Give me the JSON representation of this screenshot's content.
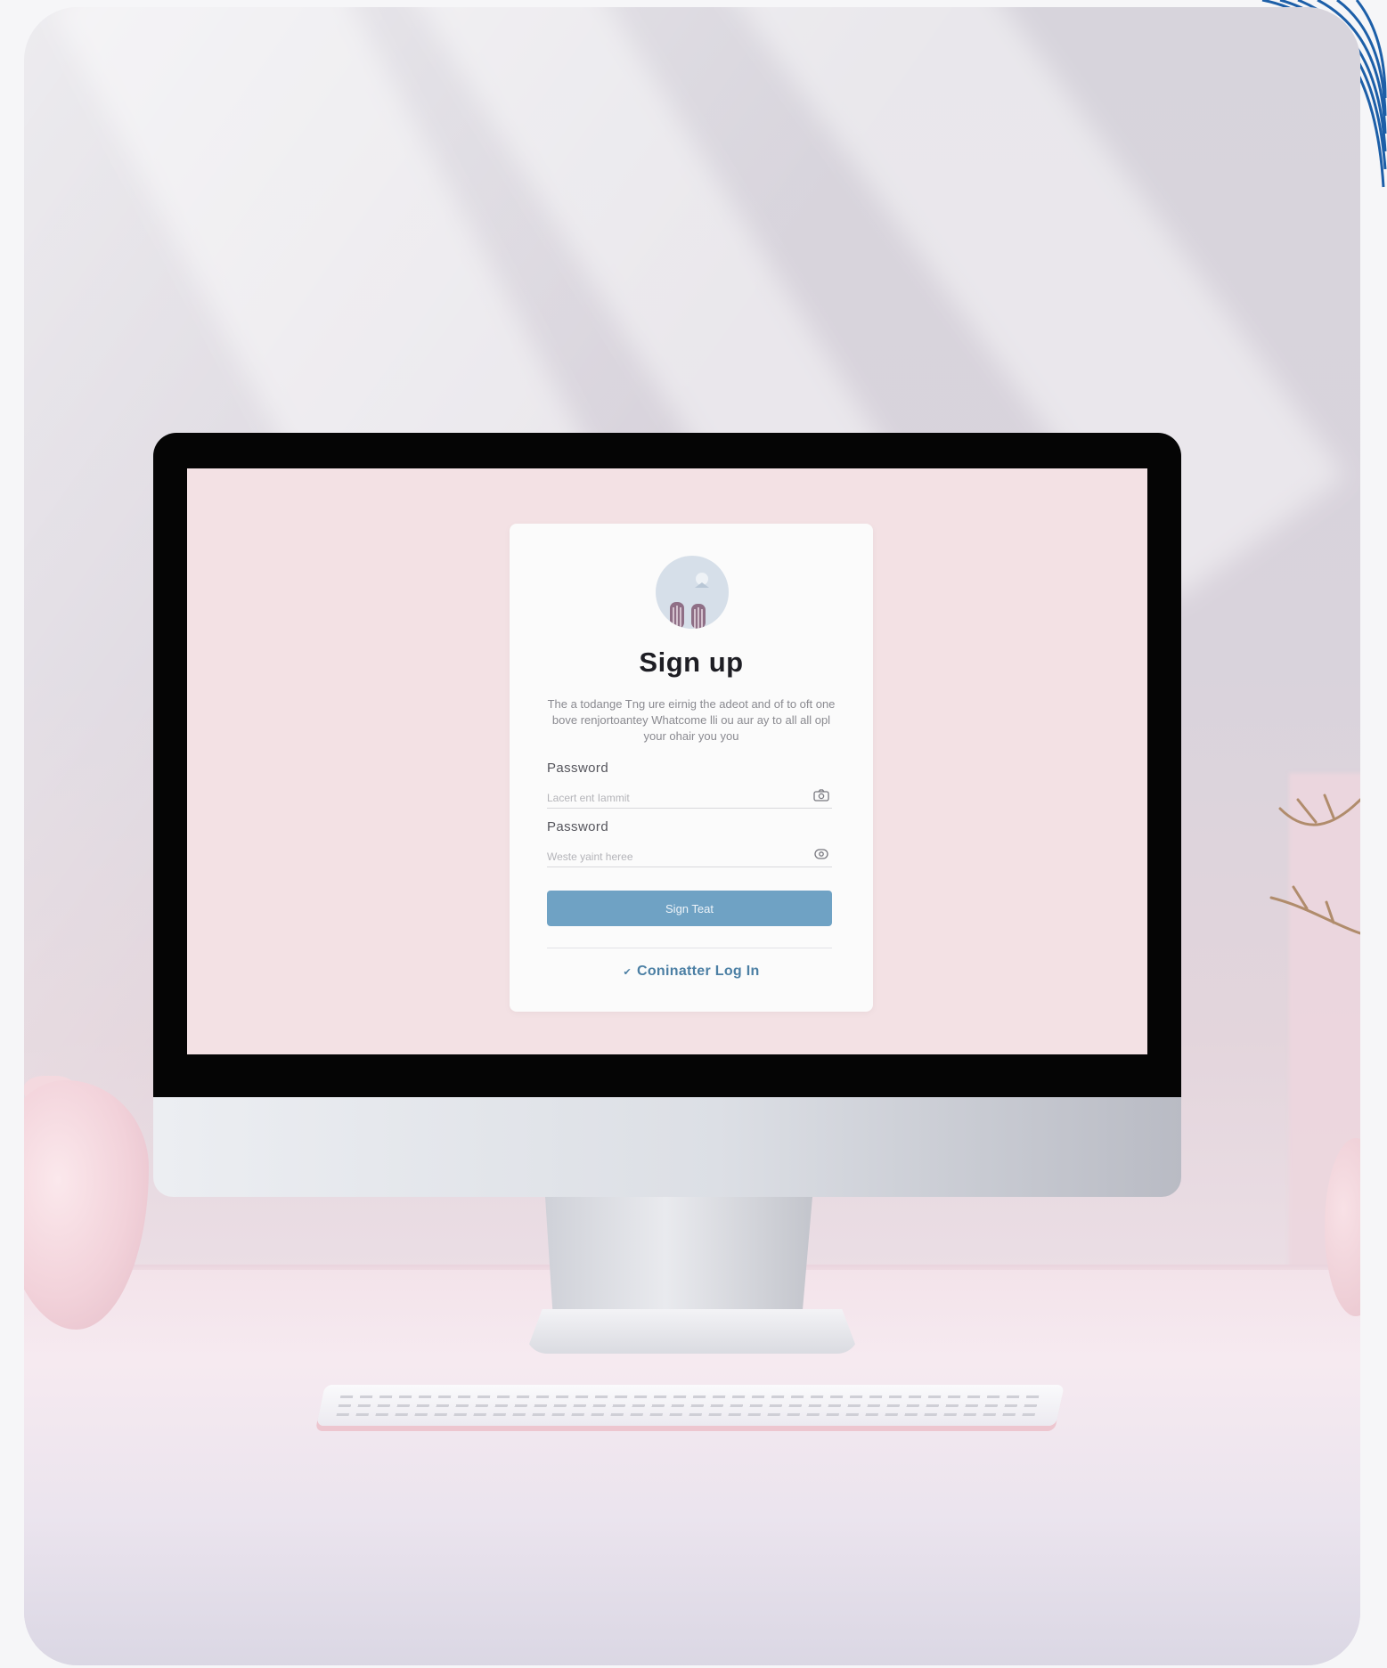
{
  "signup_card": {
    "title": "Sign up",
    "description": "The a todange Tng ure eirnig the adeot and of to oft one bove renjortoantey Whatcome lli ou aur ay to all all opl your ohair you you",
    "fields": [
      {
        "label": "Password",
        "placeholder": "Lacert ent Iammit",
        "icon": "camera-icon"
      },
      {
        "label": "Password",
        "placeholder": "Weste yaint heree",
        "icon": "eye-icon"
      }
    ],
    "submit_label": "Sign Teat",
    "login_link_label": "Coninatter Log In",
    "login_link_icon": "check-icon"
  },
  "colors": {
    "screen_bg": "#f3e1e4",
    "button": "#6fa2c4",
    "link": "#4b7fa4",
    "swirl": "#1d5fa8"
  }
}
